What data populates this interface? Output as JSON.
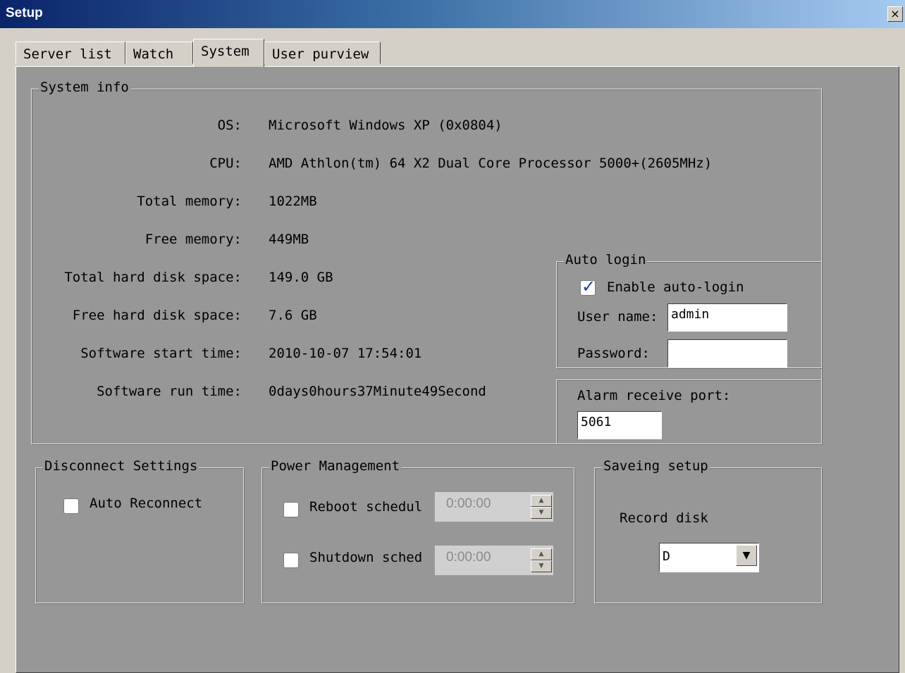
{
  "window": {
    "title": "Setup",
    "close_symbol": "×"
  },
  "tabs": [
    {
      "label": "Server list"
    },
    {
      "label": "Watch"
    },
    {
      "label": "System",
      "active": true
    },
    {
      "label": "User purview"
    }
  ],
  "system_info": {
    "title": "System info",
    "rows": [
      {
        "label": "OS:",
        "value": "Microsoft Windows XP (0x0804)"
      },
      {
        "label": "CPU:",
        "value": "AMD Athlon(tm) 64 X2 Dual Core Processor 5000+(2605MHz)"
      },
      {
        "label": "Total memory:",
        "value": "1022MB"
      },
      {
        "label": "Free memory:",
        "value": "449MB"
      },
      {
        "label": "Total hard disk space:",
        "value": "149.0 GB"
      },
      {
        "label": "Free hard disk space:",
        "value": "7.6 GB"
      },
      {
        "label": "Software start time:",
        "value": "2010-10-07 17:54:01"
      },
      {
        "label": "Software run time:",
        "value": "0days0hours37Minute49Second"
      }
    ]
  },
  "auto_login": {
    "title": "Auto login",
    "enable_label": "Enable auto-login",
    "enabled": true,
    "username_label": "User name:",
    "username_value": "admin",
    "password_label": "Password:",
    "password_value": ""
  },
  "alarm": {
    "port_label": "Alarm receive port:",
    "port_value": "5061"
  },
  "disconnect": {
    "title": "Disconnect Settings",
    "auto_reconnect_label": "Auto Reconnect",
    "auto_reconnect": false
  },
  "power": {
    "title": "Power Management",
    "reboot_label": "Reboot schedul",
    "reboot_time": "0:00:00",
    "shutdown_label": "Shutdown sched",
    "shutdown_time": "0:00:00",
    "spin_up": "▲",
    "spin_down": "▼"
  },
  "saving": {
    "title": "Saveing setup",
    "record_disk_label": "Record disk",
    "record_disk_value": "D",
    "dropdown_symbol": "▼"
  },
  "colors": {
    "titlebar_start": "#0a246a",
    "panel_bg": "#979797",
    "check_blue": "#1b3fa8"
  }
}
